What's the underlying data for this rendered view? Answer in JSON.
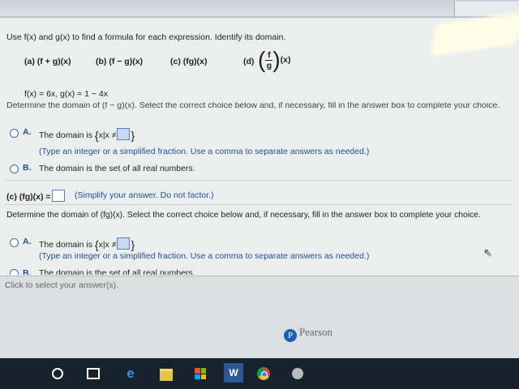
{
  "question": "Use f(x) and g(x) to find a formula for each expression. Identify its domain.",
  "parts": [
    "(a) (f + g)(x)",
    "(b) (f − g)(x)",
    "(c) (fg)(x)",
    "(d)"
  ],
  "part_d": {
    "num": "f",
    "den": "g",
    "suffix": "(x)"
  },
  "functions": "f(x) = 6x, g(x) = 1 − 4x",
  "cutoff_line": "Determine the domain of (f − g)(x). Select the correct choice below and, if necessary, fill in the answer box to complete your choice.",
  "section_b": {
    "optionA_label": "A.",
    "optionA_pre": "The domain is",
    "set_open": "{",
    "set_mid": "x|x ≠",
    "set_close": "}",
    "optionA_hint": "(Type an integer or a simplified fraction. Use a comma to separate answers as needed.)",
    "optionB_label": "B.",
    "optionB_text": "The domain is the set of all real numbers."
  },
  "part_c": {
    "label": "(c) (fg)(x) =",
    "hint": "(Simplify your answer. Do not factor.)"
  },
  "determine_c": "Determine the domain of (fg)(x). Select the correct choice below and, if necessary, fill in the answer box to complete your choice.",
  "section_c": {
    "optionA_label": "A.",
    "optionA_pre": "The domain is",
    "set_open": "{",
    "set_mid": "x|x ≠",
    "set_close": "}",
    "optionA_hint": "(Type an integer or a simplified fraction. Use a comma to separate answers as needed.)",
    "optionB_label": "B.",
    "optionB_text": "The domain is the set of all real numbers."
  },
  "footer_text": "Click to select your answer(s).",
  "brand": "Pearson",
  "brand_mark": "P",
  "taskbar_icons": [
    "cortana-circle",
    "task-view",
    "edge",
    "file-explorer",
    "store",
    "word",
    "chrome",
    "media"
  ],
  "colors": {
    "accent": "#2050a0",
    "answer_box": "#c8d8f0",
    "taskbar": "#16222e"
  }
}
